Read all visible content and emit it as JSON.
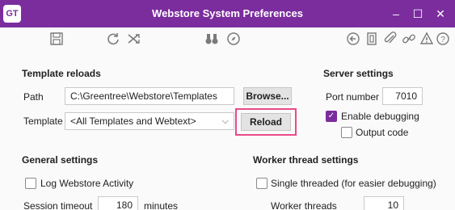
{
  "window": {
    "badge": "GT",
    "title": "Webstore System Preferences",
    "controls": {
      "minimize": "–",
      "maximize": "☐",
      "close": "✕"
    }
  },
  "toolbar": {
    "left_icons": [
      "save-icon",
      "refresh-icon",
      "shuffle-icon",
      "binoculars-icon",
      "compass-icon"
    ],
    "right_icons": [
      "back-icon",
      "document-icon",
      "attach-icon",
      "link-icon",
      "alert-icon",
      "help-icon"
    ]
  },
  "template_reloads": {
    "title": "Template reloads",
    "path_label": "Path",
    "path_value": "C:\\Greentree\\Webstore\\Templates",
    "browse_label": "Browse...",
    "template_label": "Template",
    "template_value": "<All Templates and Webtext>",
    "reload_label": "Reload"
  },
  "server_settings": {
    "title": "Server settings",
    "port_label": "Port number",
    "port_value": "7010",
    "enable_debugging_label": "Enable debugging",
    "enable_debugging_checked": true,
    "output_code_label": "Output code",
    "output_code_checked": false
  },
  "general_settings": {
    "title": "General settings",
    "log_activity_label": "Log Webstore Activity",
    "log_activity_checked": false,
    "session_timeout_label": "Session timeout",
    "session_timeout_value": "180",
    "session_timeout_unit": "minutes"
  },
  "worker_thread_settings": {
    "title": "Worker thread settings",
    "single_threaded_label": "Single threaded (for easier debugging)",
    "single_threaded_checked": false,
    "worker_threads_label": "Worker threads",
    "worker_threads_value": "10"
  },
  "colors": {
    "accent": "#7b2d9e",
    "highlight": "#e94a8a"
  }
}
